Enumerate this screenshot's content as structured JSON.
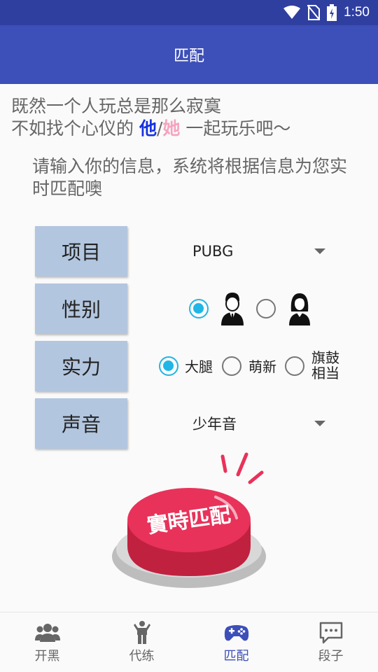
{
  "status_bar": {
    "time": "1:50"
  },
  "app_bar": {
    "title": "匹配"
  },
  "intro": {
    "line1": "既然一个人玩总是那么寂寞",
    "line2_prefix": "不如找个心仪的 ",
    "he": "他",
    "slash": "/",
    "she": "她",
    "line2_suffix": " 一起玩乐吧～"
  },
  "prompt": "请输入你的信息，系统将根据信息为您实时匹配噢",
  "form": {
    "project": {
      "label": "项目",
      "value": "PUBG"
    },
    "gender": {
      "label": "性别",
      "selected": "male"
    },
    "skill": {
      "label": "实力",
      "options": [
        "大腿",
        "萌新",
        "旗鼓相当"
      ],
      "selected": "大腿"
    },
    "voice": {
      "label": "声音",
      "value": "少年音"
    }
  },
  "match_button": {
    "label": "實時匹配"
  },
  "bottom_nav": {
    "items": [
      {
        "label": "开黑",
        "icon": "group-icon"
      },
      {
        "label": "代练",
        "icon": "person-icon"
      },
      {
        "label": "匹配",
        "icon": "gamepad-icon",
        "active": true
      },
      {
        "label": "段子",
        "icon": "chat-icon"
      }
    ]
  },
  "colors": {
    "primary": "#3d4fb8",
    "status": "#2f3fa0",
    "accent": "#20b6e6",
    "label_bg": "#b3c6df",
    "button_red": "#e8325a"
  }
}
